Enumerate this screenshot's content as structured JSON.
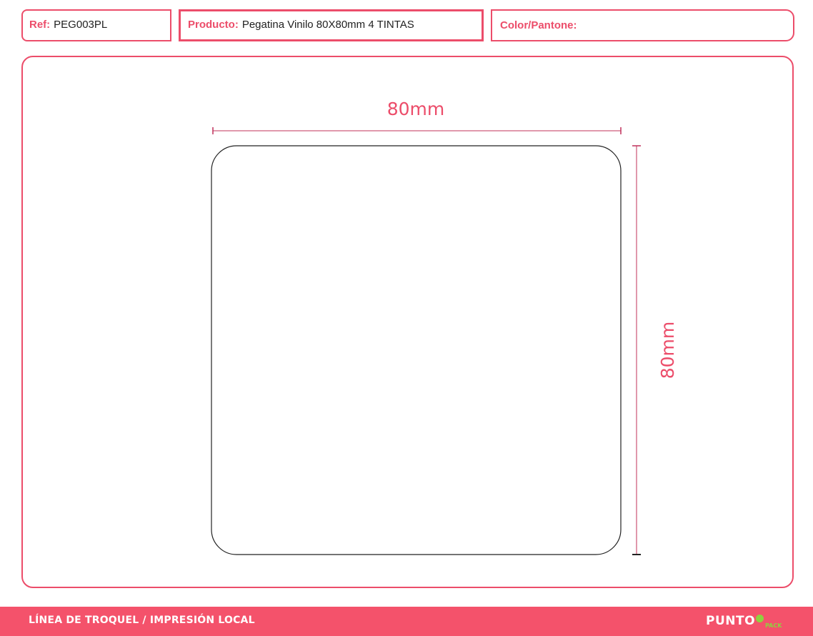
{
  "header": {
    "ref": {
      "label": "Ref:",
      "value": "PEG003PL"
    },
    "product": {
      "label": "Producto:",
      "value": "Pegatina Vinilo 80X80mm 4 TINTAS"
    },
    "color": {
      "label": "Color/Pantone:",
      "value": ""
    }
  },
  "drawing": {
    "width_label": "80mm",
    "height_label": "80mm"
  },
  "footer": {
    "title": "LÍNEA DE TROQUEL / IMPRESIÓN LOCAL",
    "logo": {
      "word": "PUNTO",
      "sub": "PACK"
    }
  },
  "colors": {
    "accent": "#ec4d6a",
    "footer_bg": "#f4526b",
    "dimension_line": "#c0305a",
    "die_line": "#222222",
    "logo_green": "#8fd13f"
  }
}
